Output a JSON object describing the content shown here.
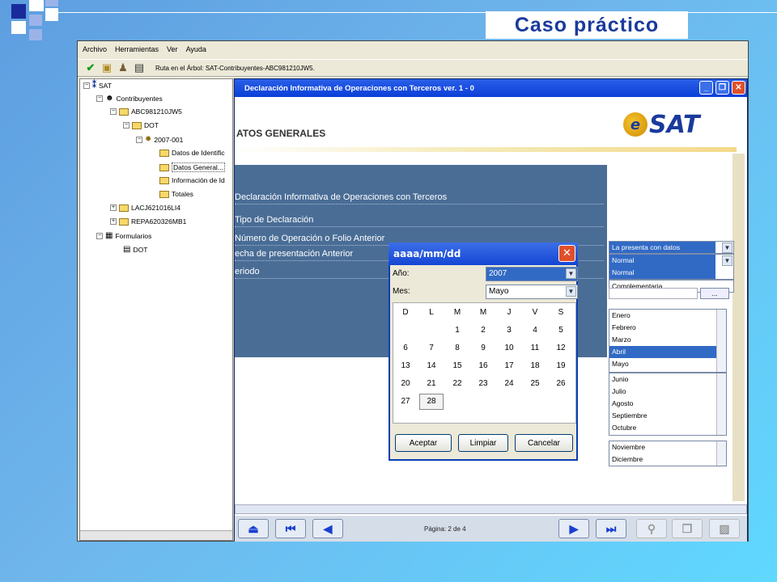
{
  "slide": {
    "title": "Caso práctico"
  },
  "menu": [
    "Archivo",
    "Herramientas",
    "Ver",
    "Ayuda"
  ],
  "toolbar": {
    "route": "Ruta en el Árbol: SAT-Contribuyentes-ABC981210JW5."
  },
  "tree": {
    "root": "SAT",
    "contribuyentes": "Contribuyentes",
    "rfc1": "ABC981210JW5",
    "dot": "DOT",
    "period": "2007-001",
    "leaves": [
      "Datos de Identific",
      "Datos General...",
      "Información de Id",
      "Totales"
    ],
    "rfc2": "LACJ621016LI4",
    "rfc3": "REPA620326MB1",
    "formularios": "Formularios",
    "dot2": "DOT"
  },
  "form": {
    "title": "Declaración Informativa de Operaciones con Terceros ver. 1 - 0",
    "section_title": "ATOS GENERALES",
    "logo_text": "SAT",
    "fields": [
      "Declaración Informativa de Operaciones con Terceros",
      "Tipo de Declaración",
      "Número de Operación o Folio Anterior",
      "echa de presentación Anterior",
      "eriodo"
    ],
    "combo1": {
      "options": [
        "La presenta con datos",
        "Normal"
      ]
    },
    "combo2": {
      "options": [
        "Normal",
        "Complementaria"
      ]
    },
    "folio_btn": "...",
    "months_top": [
      "Enero",
      "Febrero",
      "Marzo",
      "Abril",
      "Mayo"
    ],
    "months_mid": [
      "Junio",
      "Julio",
      "Agosto",
      "Septiembre",
      "Octubre"
    ],
    "months_bottom": [
      "Noviembre",
      "Diciembre"
    ],
    "page_indicator": "Página: 2 de 4"
  },
  "dialog": {
    "title": "aaaa/mm/dd",
    "year_label": "Año:",
    "year_value": "2007",
    "month_label": "Mes:",
    "month_value": "Mayo",
    "weekdays": [
      "D",
      "L",
      "M",
      "M",
      "J",
      "V",
      "S"
    ],
    "days": [
      [
        "",
        "",
        "1",
        "2",
        "3",
        "4",
        "5"
      ],
      [
        "6",
        "7",
        "8",
        "9",
        "10",
        "11",
        "12"
      ],
      [
        "13",
        "14",
        "15",
        "16",
        "17",
        "18",
        "19"
      ],
      [
        "20",
        "21",
        "22",
        "23",
        "24",
        "25",
        "26"
      ],
      [
        "27",
        "28",
        "",
        "",
        "",
        "",
        ""
      ]
    ],
    "today": "28",
    "buttons": {
      "accept": "Aceptar",
      "clear": "Limpiar",
      "cancel": "Cancelar"
    }
  },
  "colors": {
    "title_text": "#1a3a9c",
    "form_titlebar": "#0a3fd8",
    "panel": "#4a6d96",
    "selection": "#316ac5"
  }
}
